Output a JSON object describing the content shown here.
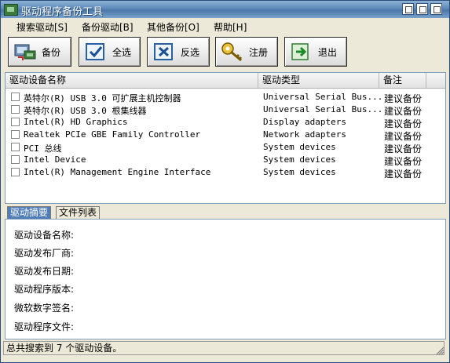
{
  "window": {
    "title": "驱动程序备份工具"
  },
  "menu": [
    {
      "label": "搜索驱动[S]"
    },
    {
      "label": "备份驱动[B]"
    },
    {
      "label": "其他备份[O]"
    },
    {
      "label": "帮助[H]"
    }
  ],
  "toolbar": {
    "backup": "备份",
    "select_all": "全选",
    "invert": "反选",
    "register": "注册",
    "exit": "退出"
  },
  "list": {
    "headers": {
      "name": "驱动设备名称",
      "type": "驱动类型",
      "note": "备注"
    },
    "rows": [
      {
        "name": "英特尔(R) USB 3.0 可扩展主机控制器",
        "type": "Universal Serial Bus...",
        "note": "建议备份"
      },
      {
        "name": "英特尔(R) USB 3.0 根集线器",
        "type": "Universal Serial Bus...",
        "note": "建议备份"
      },
      {
        "name": "Intel(R) HD Graphics",
        "type": "Display adapters",
        "note": "建议备份"
      },
      {
        "name": "Realtek PCIe GBE Family Controller",
        "type": "Network adapters",
        "note": "建议备份"
      },
      {
        "name": "PCI 总线",
        "type": "System devices",
        "note": "建议备份"
      },
      {
        "name": "Intel Device",
        "type": "System devices",
        "note": "建议备份"
      },
      {
        "name": "Intel(R) Management Engine Interface",
        "type": "System devices",
        "note": "建议备份"
      }
    ]
  },
  "tabs": {
    "summary": "驱动摘要",
    "files": "文件列表"
  },
  "details": {
    "device_name": "驱动设备名称:",
    "vendor": "驱动发布厂商:",
    "date": "驱动发布日期:",
    "version": "驱动程序版本:",
    "signature": "微软数字签名:",
    "files": "驱动程序文件:"
  },
  "status": "总共搜索到 7 个驱动设备。"
}
